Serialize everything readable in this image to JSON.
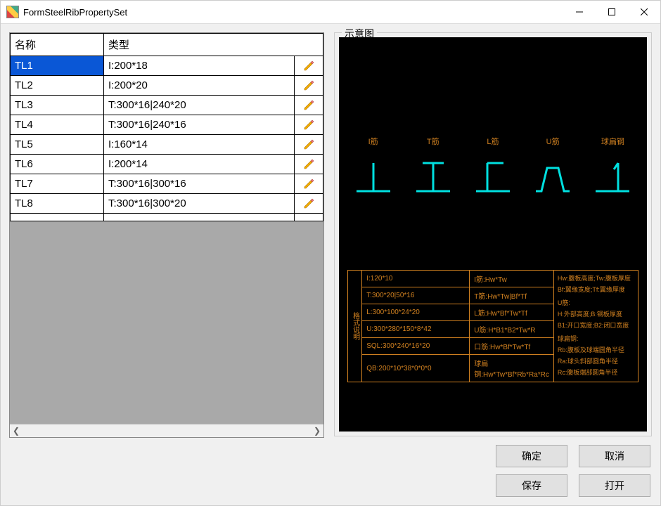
{
  "window": {
    "title": "FormSteelRibPropertySet"
  },
  "grid": {
    "headers": {
      "name": "名称",
      "type": "类型"
    },
    "rows": [
      {
        "name": "TL1",
        "type": "I:200*18",
        "selected": true
      },
      {
        "name": "TL2",
        "type": "I:200*20",
        "selected": false
      },
      {
        "name": "TL3",
        "type": "T:300*16|240*20",
        "selected": false
      },
      {
        "name": "TL4",
        "type": "T:300*16|240*16",
        "selected": false
      },
      {
        "name": "TL5",
        "type": "I:160*14",
        "selected": false
      },
      {
        "name": "TL6",
        "type": "I:200*14",
        "selected": false
      },
      {
        "name": "TL7",
        "type": "T:300*16|300*16",
        "selected": false
      },
      {
        "name": "TL8",
        "type": "T:300*16|300*20",
        "selected": false
      },
      {
        "name": "",
        "type": "",
        "selected": false
      }
    ]
  },
  "diagram": {
    "legend": "示意图",
    "shapes": [
      {
        "label": "I筋"
      },
      {
        "label": "T筋"
      },
      {
        "label": "L筋"
      },
      {
        "label": "U筋"
      },
      {
        "label": "球扁钢"
      }
    ],
    "tableSideLabel": "格式说明",
    "tableRows": [
      {
        "a": "I:120*10",
        "b": "I筋:Hw*Tw"
      },
      {
        "a": "T:300*20|50*16",
        "b": "T筋:Hw*Tw|Bf*Tf"
      },
      {
        "a": "L:300*100*24*20",
        "b": "L筋:Hw*Bf*Tw*Tf"
      },
      {
        "a": "U:300*280*150*8*42",
        "b": "U筋:H*B1*B2*Tw*R"
      },
      {
        "a": "SQL:300*240*16*20",
        "b": "口筋:Hw*Bf*Tw*Tf"
      },
      {
        "a": "QB:200*10*38*0*0*0",
        "b": "球扁钢:Hw*Tw*Bf*Rb*Ra*Rc"
      }
    ],
    "tableRight": [
      "Hw:腹板高度;Tw:腹板厚度",
      "Bf:翼缘宽度;Tf:翼缘厚度",
      "",
      "U筋:",
      "H:外部高度;B:钢板厚度",
      "B1:开口宽度;B2:闭口宽度",
      "",
      "球扁钢:",
      "Rb:腹板及球端圆角半径",
      "Ra:球头斜部圆角半径",
      "Rc:腹板端部圆角半径"
    ]
  },
  "buttons": {
    "ok": "确定",
    "cancel": "取消",
    "save": "保存",
    "open": "打开"
  }
}
